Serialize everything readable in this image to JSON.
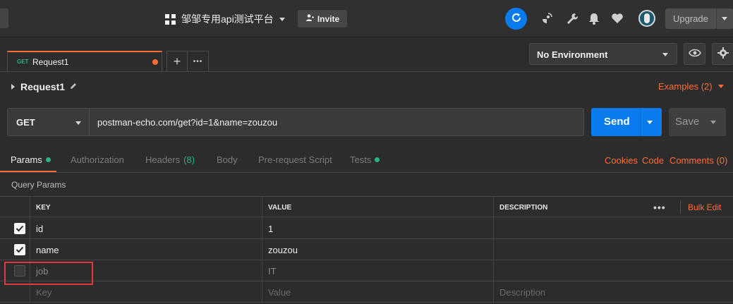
{
  "header": {
    "workspace_name": "邹邹专用api测试平台",
    "invite_label": "Invite",
    "upgrade_label": "Upgrade"
  },
  "tabs": {
    "active": {
      "method": "GET",
      "name": "Request1",
      "unsaved": true
    },
    "new_tab_symbol": "+",
    "more_symbol": "•••"
  },
  "environment": {
    "selected": "No Environment"
  },
  "request": {
    "name": "Request1",
    "examples_label": "Examples (2)",
    "method": "GET",
    "url": "postman-echo.com/get?id=1&name=zouzou",
    "send_label": "Send",
    "save_label": "Save"
  },
  "request_tabs": [
    {
      "label": "Params",
      "active": true,
      "indicator": true
    },
    {
      "label": "Authorization"
    },
    {
      "label": "Headers",
      "count": "(8)"
    },
    {
      "label": "Body"
    },
    {
      "label": "Pre-request Script"
    },
    {
      "label": "Tests",
      "indicator": true
    }
  ],
  "request_links": {
    "cookies": "Cookies",
    "code": "Code",
    "comments": "Comments (0)"
  },
  "params": {
    "section_title": "Query Params",
    "columns": {
      "key": "KEY",
      "value": "VALUE",
      "description": "DESCRIPTION"
    },
    "bulk_edit_label": "Bulk Edit",
    "more_label": "•••",
    "rows": [
      {
        "checked": true,
        "key": "id",
        "value": "1",
        "description": ""
      },
      {
        "checked": true,
        "key": "name",
        "value": "zouzou",
        "description": ""
      },
      {
        "checked": false,
        "key": "job",
        "value": "IT",
        "description": ""
      }
    ],
    "placeholders": {
      "key": "Key",
      "value": "Value",
      "description": "Description"
    }
  },
  "colors": {
    "accent": "#ff6c37",
    "primary_button": "#097bed",
    "indicator_green": "#26b47f",
    "annotation_box": "#e03b3b"
  },
  "icons": [
    "grid-icon",
    "add-user-icon",
    "sync-icon",
    "satellite-icon",
    "wrench-icon",
    "bell-icon",
    "heart-icon",
    "eye-icon",
    "gear-icon",
    "pencil-icon",
    "check-icon"
  ]
}
